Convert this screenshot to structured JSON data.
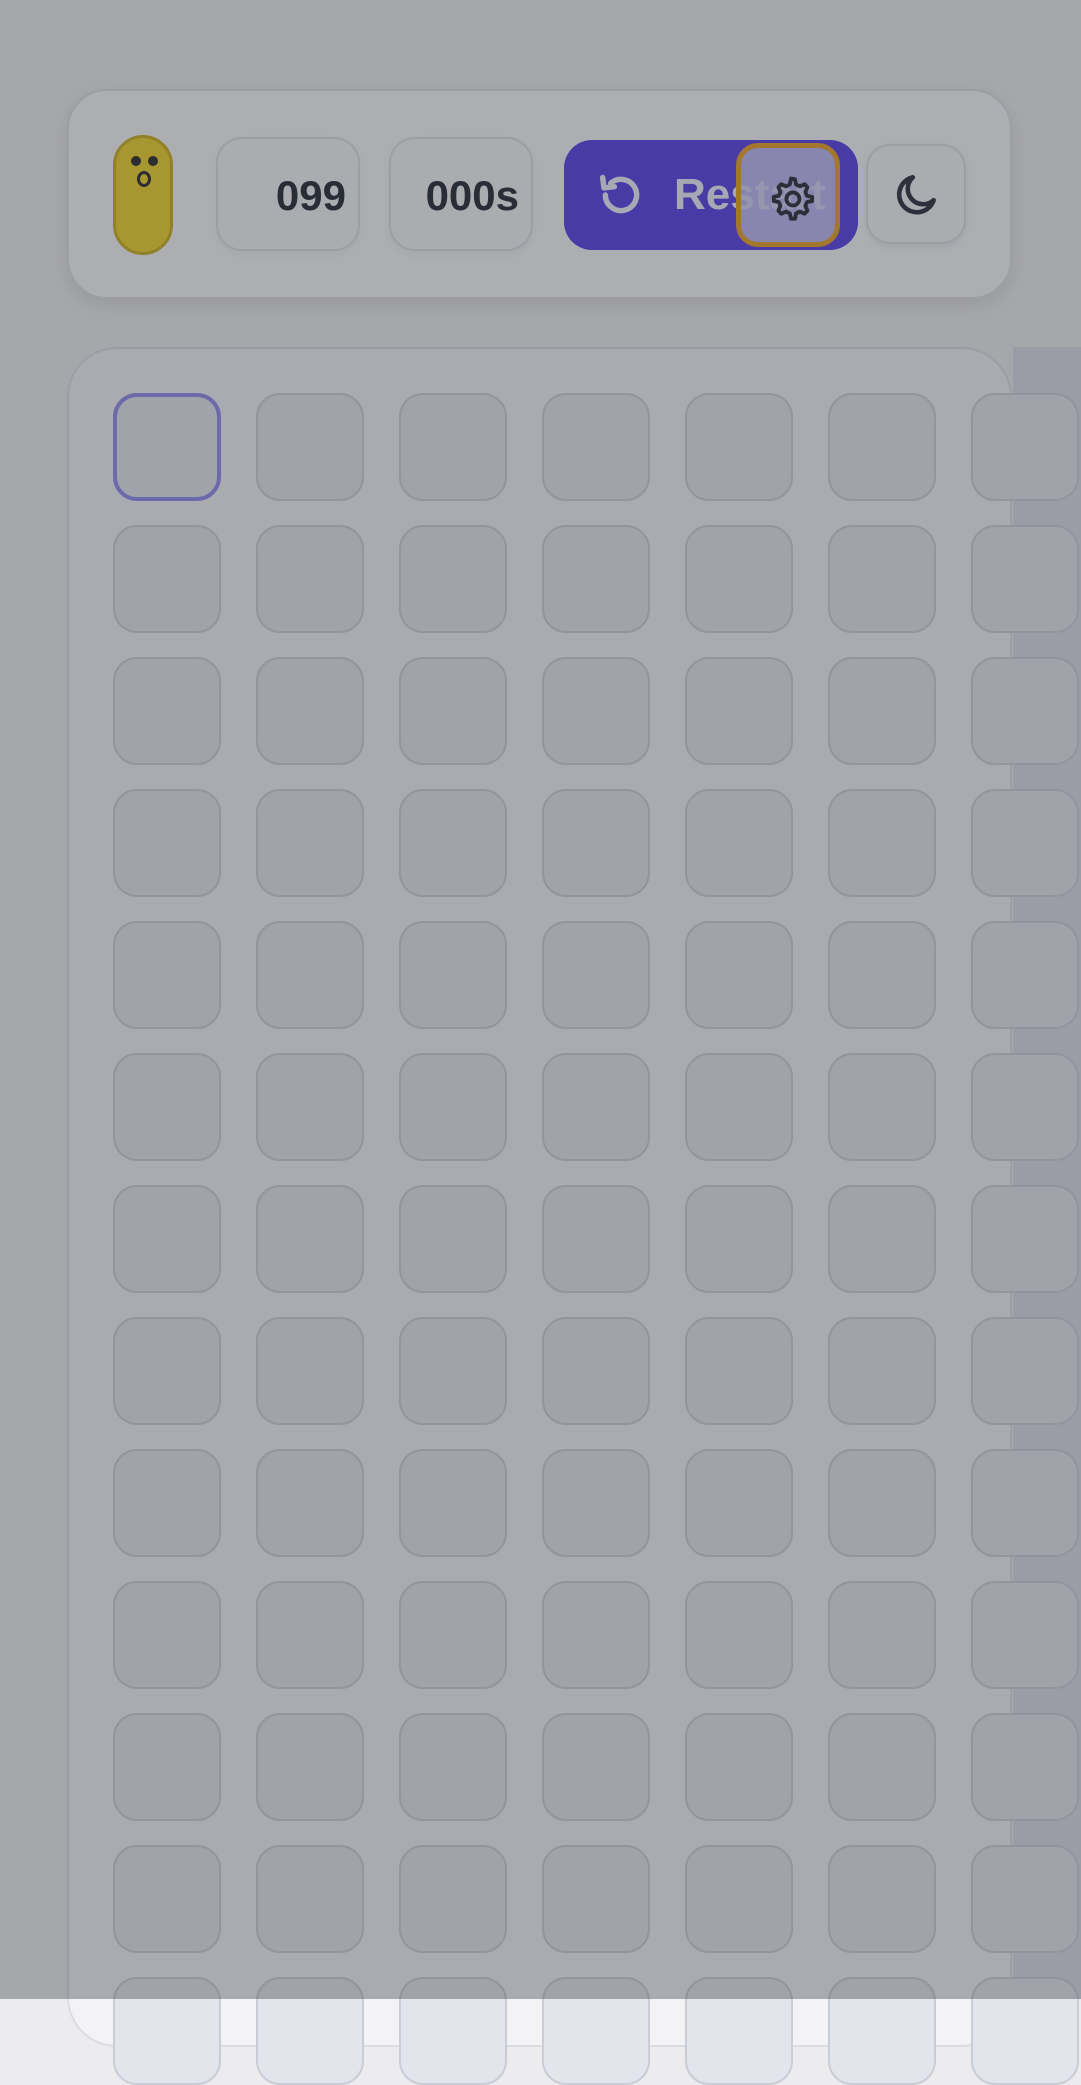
{
  "header": {
    "mine_counter": "099",
    "timer": "000s",
    "restart_label": "Restart",
    "smiley_icon": "surprised-face-icon",
    "restart_icon": "restart-arrow-icon",
    "settings_icon": "gear-icon",
    "theme_icon": "moon-icon"
  },
  "board": {
    "visible_rows": 13,
    "visible_cols": 7,
    "focused_cell": [
      0,
      0
    ]
  },
  "colors": {
    "accent": "#4a32e6",
    "focus_ring": "#e79a16",
    "smiley": "#efd01b"
  }
}
